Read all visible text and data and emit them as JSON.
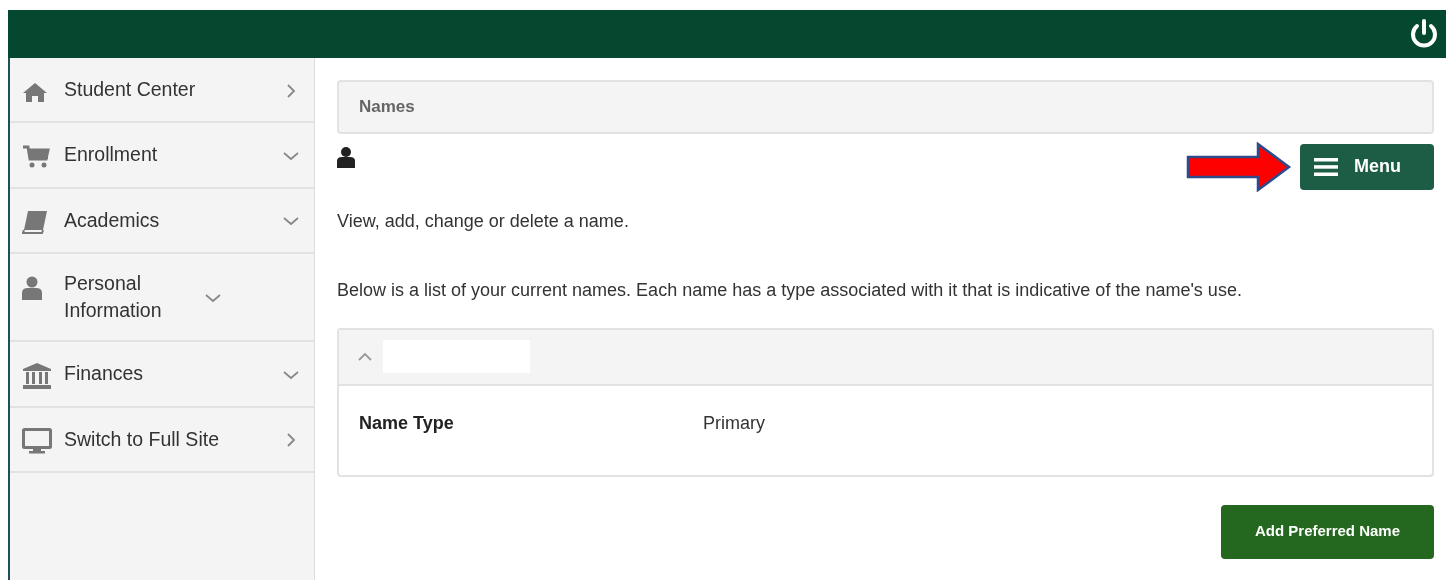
{
  "sidebar": {
    "items": [
      {
        "label": "Student Center",
        "kind": "link"
      },
      {
        "label": "Enrollment",
        "kind": "menu"
      },
      {
        "label": "Academics",
        "kind": "menu"
      },
      {
        "label": "Personal Information",
        "kind": "menu"
      },
      {
        "label": "Finances",
        "kind": "menu"
      },
      {
        "label": "Switch to Full Site",
        "kind": "link"
      }
    ]
  },
  "page_title": "Names",
  "menu_button": {
    "label": "Menu"
  },
  "intro": "View, add, change or delete a name.",
  "description": "Below is a list of your current names. Each name has a type associated with it that is indicative of the name's use.",
  "name_card": {
    "expanded": true,
    "fields": [
      {
        "label": "Name Type",
        "value": "Primary"
      }
    ]
  },
  "add_button": {
    "label": "Add Preferred Name"
  }
}
